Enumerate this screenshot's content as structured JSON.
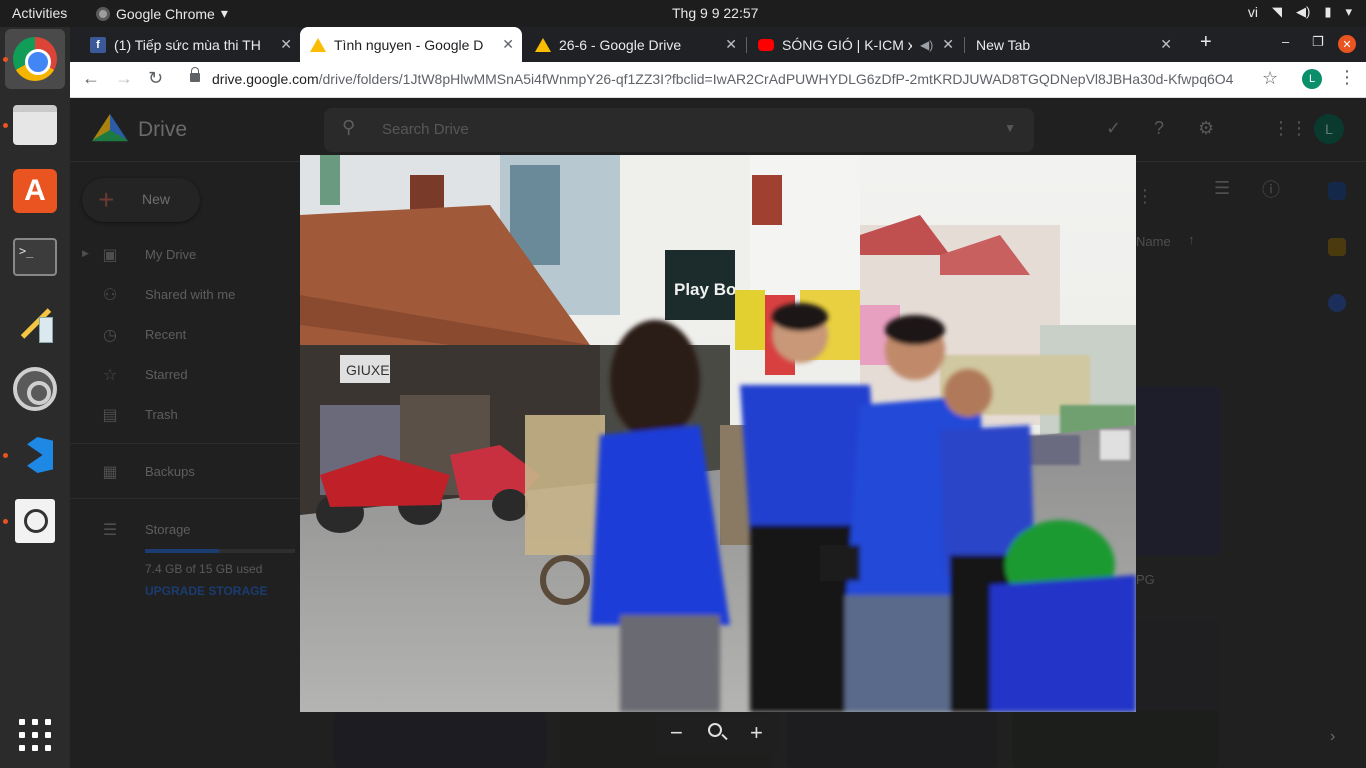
{
  "topbar": {
    "activities": "Activities",
    "app_name": "Google Chrome",
    "app_menu_arrow": "▾",
    "clock": "Thg 9 9  22:57",
    "lang": "vi",
    "battery_icon": "battery-icon",
    "wifi_icon": "wifi-icon",
    "volume_icon": "volume-icon"
  },
  "dock": {
    "items": [
      "chrome-icon",
      "files-icon",
      "software-icon",
      "terminal-icon",
      "paint-icon",
      "settings-icon",
      "vscode-icon",
      "screenshot-search-icon"
    ],
    "show_apps_icon": "apps-grid-icon"
  },
  "browser": {
    "tabs": [
      {
        "title": "(1) Tiếp sức mùa thi TH",
        "favicon": "facebook-icon"
      },
      {
        "title": "Tình nguyen - Google D",
        "favicon": "drive-icon"
      },
      {
        "title": "26-6 - Google Drive",
        "favicon": "drive-icon"
      },
      {
        "title": "SÓNG GIÓ | K-ICM x",
        "favicon": "youtube-icon"
      },
      {
        "title": "New Tab",
        "favicon": ""
      }
    ],
    "url_host": "drive.google.com",
    "url_path": "/drive/folders/1JtW8pHlwMMSnA5i4fWnmpY26-qf1ZZ3I?fbclid=IwAR2CrAdPUWHYDLG6zDfP-2mtKRDJUWAD8TGQDNepVl8JBHa30d-Kfwpq6O4",
    "profile_initial": "L"
  },
  "drive": {
    "logo_text": "Drive",
    "search_placeholder": "Search Drive",
    "new_label": "New",
    "nav": [
      {
        "label": "My Drive",
        "icon": "my-drive-icon"
      },
      {
        "label": "Shared with me",
        "icon": "people-icon"
      },
      {
        "label": "Recent",
        "icon": "clock-icon"
      },
      {
        "label": "Starred",
        "icon": "star-icon"
      },
      {
        "label": "Trash",
        "icon": "trash-icon"
      }
    ],
    "backups_label": "Backups",
    "storage_label": "Storage",
    "storage_used": "7.4 GB of 15 GB used",
    "storage_fraction": 0.49,
    "upgrade_label": "UPGRADE STORAGE",
    "sort_label": "Name",
    "file_suffix": "PG",
    "avatar_initial": "L"
  },
  "viewer": {
    "zoom_out": "−",
    "zoom_in": "+",
    "photo_sign_1": "Play Boy",
    "photo_sign_2": "GIUXE",
    "next_chevron": "›"
  }
}
